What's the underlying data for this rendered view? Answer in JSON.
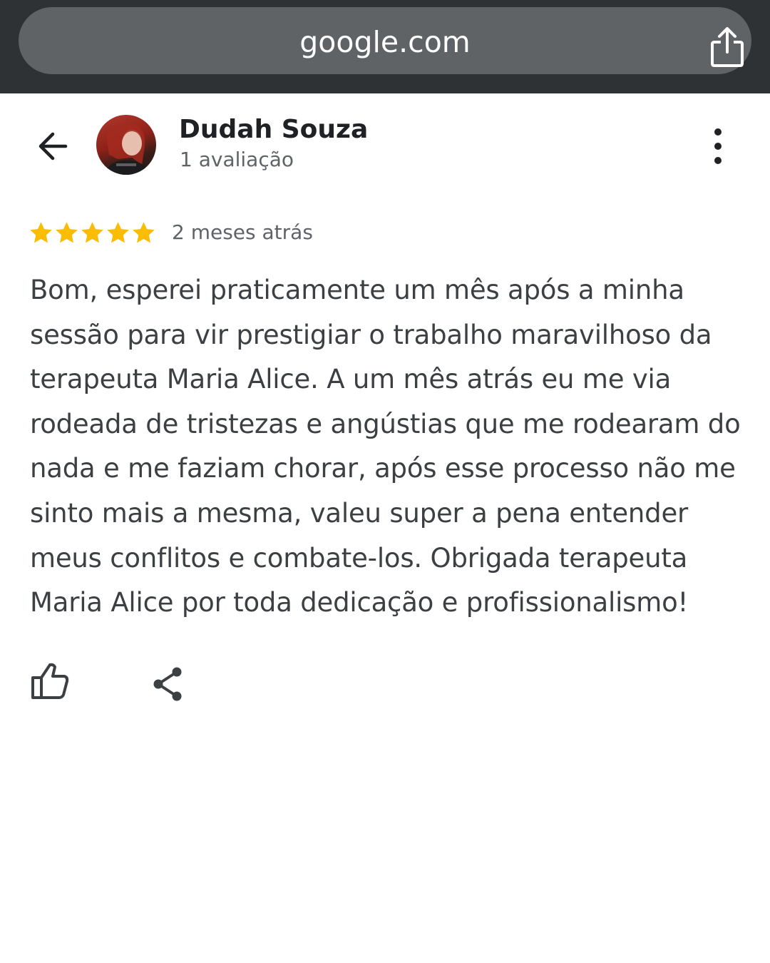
{
  "browser": {
    "url": "google.com",
    "share_icon": "share-upload-icon"
  },
  "reviewer": {
    "name": "Dudah Souza",
    "review_count": "1 avaliação"
  },
  "review": {
    "rating": 5,
    "rating_max": 5,
    "star_color": "#fbbc04",
    "date": "2 meses atrás",
    "text": "Bom, esperei praticamente um mês após a minha sessão para vir prestigiar o trabalho maravilhoso da terapeuta Maria Alice. A um mês atrás eu me via rodeada de tristezas e angústias que me rodearam do nada e me faziam chorar, após esse processo não me sinto mais a mesma, valeu super a pena entender meus conflitos e combate-los. Obrigada terapeuta Maria Alice por toda dedicação e profissionalismo!"
  },
  "actions": {
    "icons": [
      "back-arrow-icon",
      "more-vert-icon",
      "thumbs-up-icon",
      "share-icon"
    ]
  }
}
